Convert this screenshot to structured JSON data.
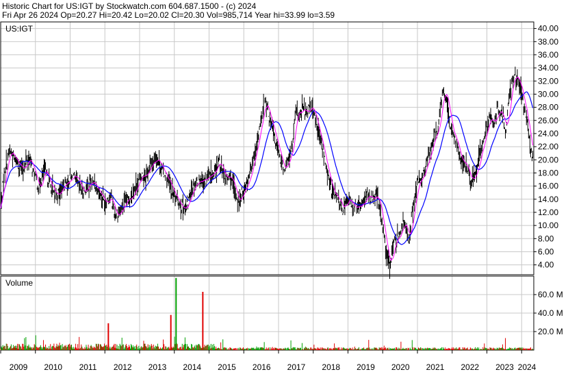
{
  "header": {
    "line1": "Historic Chart for US:IGT by Stockwatch.com 604.687.1500 - (c) 2024",
    "line2": "Fri Apr 26 2024   Op=20.27   Hi=20.42   Lo=20.02   Cl=20.30   Vol=985,714   Year hi=33.99   lo=3.59"
  },
  "colors": {
    "grid": "#c8c8c8",
    "price_bar": "#000000",
    "ma_short": "#ff00ff",
    "ma_long": "#0000ff",
    "vol_up": "#00a000",
    "vol_down": "#e00000"
  },
  "chart_data": [
    {
      "type": "line",
      "title": "US:IGT",
      "ylim": [
        2.5,
        41
      ],
      "y_ticks": [
        "40.00",
        "38.00",
        "36.00",
        "34.00",
        "32.00",
        "30.00",
        "28.00",
        "26.00",
        "24.00",
        "22.00",
        "20.00",
        "18.00",
        "16.00",
        "14.00",
        "12.00",
        "10.00",
        "8.00",
        "6.00",
        "4.00"
      ],
      "x_ticks": [
        "2009",
        "2010",
        "2011",
        "2012",
        "2013",
        "2014",
        "2015",
        "2016",
        "2017",
        "2018",
        "2019",
        "2020",
        "2021",
        "2022",
        "2023",
        "2024"
      ],
      "x_range": [
        2009.0,
        2024.35
      ],
      "series": [
        {
          "x": [
            2009.0,
            2009.1,
            2009.25,
            2009.4,
            2009.5,
            2009.65,
            2009.8,
            2009.95,
            2010.1,
            2010.25,
            2010.4,
            2010.55,
            2010.7,
            2010.85,
            2011.0,
            2011.1,
            2011.25,
            2011.4,
            2011.55,
            2011.7,
            2011.85,
            2012.0,
            2012.15,
            2012.3,
            2012.5,
            2012.6,
            2012.75,
            2012.9,
            2013.05,
            2013.2,
            2013.35,
            2013.5,
            2013.65,
            2013.8,
            2013.95,
            2014.05,
            2014.2,
            2014.35,
            2014.45,
            2014.6,
            2014.75,
            2014.9,
            2015.05,
            2015.15,
            2015.3,
            2015.45,
            2015.6,
            2015.75,
            2015.85,
            2016.0,
            2016.15,
            2016.3,
            2016.4,
            2016.5,
            2016.6,
            2016.7,
            2016.85,
            2016.95,
            2017.05,
            2017.15,
            2017.25,
            2017.4,
            2017.5,
            2017.6,
            2017.7,
            2017.8,
            2017.9,
            2018.0,
            2018.1,
            2018.25,
            2018.4,
            2018.55,
            2018.7,
            2018.85,
            2019.0,
            2019.15,
            2019.3,
            2019.45,
            2019.6,
            2019.75,
            2019.85,
            2019.95,
            2020.05,
            2020.12,
            2020.2,
            2020.3,
            2020.45,
            2020.6,
            2020.75,
            2020.85,
            2021.0,
            2021.15,
            2021.3,
            2021.45,
            2021.6,
            2021.75,
            2021.85,
            2021.95,
            2022.1,
            2022.25,
            2022.4,
            2022.55,
            2022.7,
            2022.85,
            2023.0,
            2023.1,
            2023.2,
            2023.3,
            2023.45,
            2023.55,
            2023.65,
            2023.8,
            2023.95,
            2024.05,
            2024.15,
            2024.25,
            2024.32
          ],
          "close": [
            12.5,
            18.0,
            21.5,
            20.0,
            19.5,
            18.5,
            20.5,
            18.0,
            15.5,
            18.5,
            16.5,
            14.5,
            15.0,
            16.5,
            17.0,
            17.5,
            16.0,
            15.0,
            16.5,
            16.5,
            15.0,
            13.5,
            14.5,
            11.5,
            12.5,
            13.5,
            14.5,
            16.0,
            17.5,
            18.0,
            19.5,
            20.5,
            18.5,
            17.0,
            15.0,
            14.0,
            13.0,
            12.5,
            15.0,
            16.5,
            17.0,
            17.0,
            17.5,
            18.0,
            20.0,
            17.0,
            17.5,
            15.0,
            13.5,
            15.5,
            17.5,
            21.0,
            23.0,
            26.0,
            29.0,
            27.0,
            24.0,
            22.0,
            20.0,
            18.5,
            19.5,
            22.0,
            27.5,
            26.5,
            28.0,
            27.0,
            28.5,
            27.5,
            25.0,
            22.0,
            18.0,
            15.0,
            14.0,
            12.5,
            14.0,
            13.0,
            12.5,
            14.0,
            14.5,
            14.0,
            14.5,
            11.0,
            8.5,
            5.0,
            4.0,
            7.0,
            8.5,
            10.5,
            8.0,
            12.0,
            16.5,
            17.5,
            20.0,
            23.0,
            25.0,
            31.0,
            28.5,
            25.0,
            23.0,
            20.0,
            19.0,
            16.5,
            18.5,
            22.0,
            25.0,
            26.5,
            25.5,
            27.5,
            26.5,
            24.5,
            30.0,
            33.5,
            31.0,
            28.5,
            26.0,
            21.5,
            20.3
          ],
          "name": ""
        }
      ]
    },
    {
      "type": "bar",
      "title": "Volume",
      "ylim": [
        0,
        80
      ],
      "y_ticks": [
        "60.0 M",
        "40.0 M",
        "20.0 M"
      ],
      "spikes": [
        {
          "x": 2012.1,
          "value": 29,
          "dir": "down"
        },
        {
          "x": 2013.9,
          "value": 38,
          "dir": "down"
        },
        {
          "x": 2014.05,
          "value": 78,
          "dir": "up"
        },
        {
          "x": 2014.82,
          "value": 63,
          "dir": "down"
        }
      ]
    }
  ]
}
